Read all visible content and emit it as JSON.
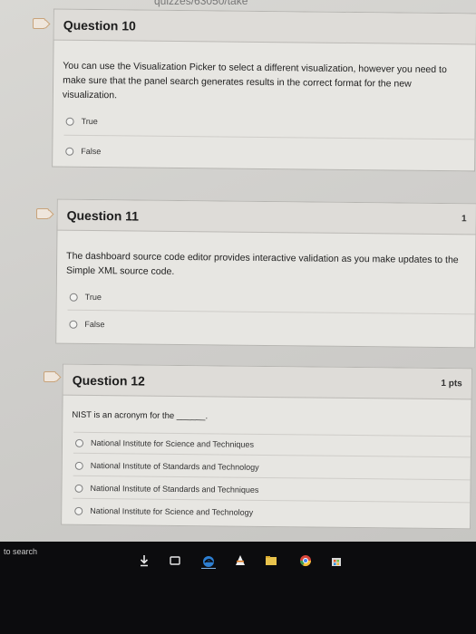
{
  "url_fragment": "quizzes/63050/take",
  "questions": [
    {
      "title": "Question 10",
      "points": "",
      "text": "You can use the Visualization Picker to select a different visualization, however you need to make sure that the panel search generates results in the correct format for the new visualization.",
      "options": [
        "True",
        "False"
      ]
    },
    {
      "title": "Question 11",
      "points": "1",
      "text": "The dashboard source code editor provides interactive validation as you make updates to the Simple XML source code.",
      "options": [
        "True",
        "False"
      ]
    },
    {
      "title": "Question 12",
      "points": "1 pts",
      "text": "NIST is an acronym for the ______.",
      "options": [
        "National Institute for Science and Techniques",
        "National Institute of Standards and Technology",
        "National Institute of Standards and Techniques",
        "National Institute for Science and Technology"
      ]
    }
  ],
  "taskbar": {
    "search_text": "to search",
    "icons": [
      "download-icon",
      "task-view-icon",
      "edge-icon",
      "vlc-icon",
      "file-explorer-icon",
      "chrome-icon",
      "store-icon"
    ]
  }
}
